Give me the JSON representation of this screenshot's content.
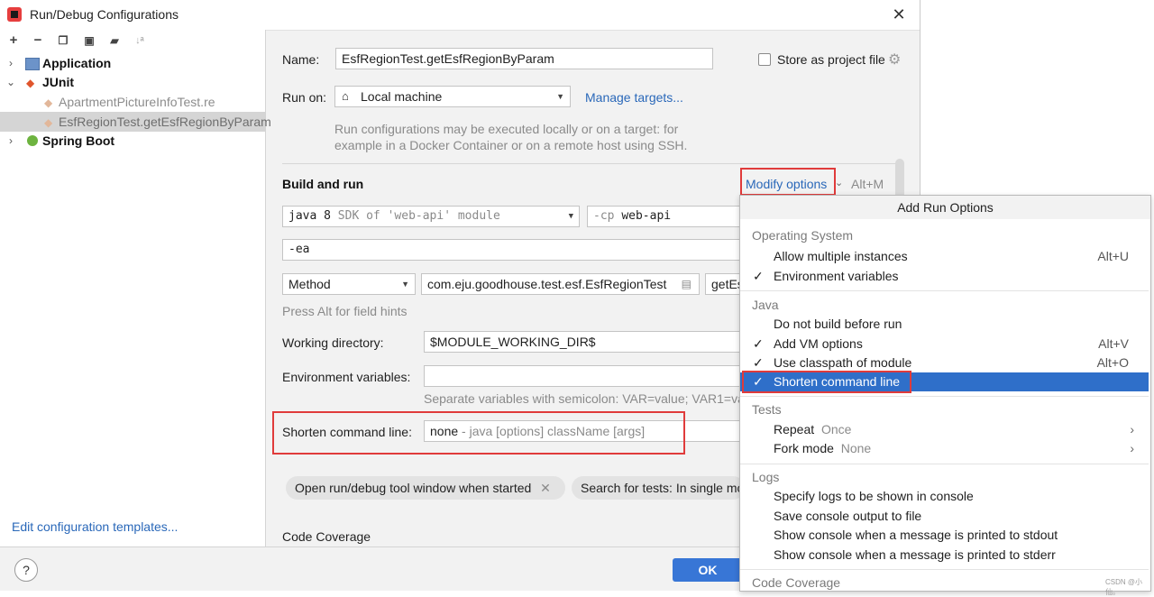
{
  "window": {
    "title": "Run/Debug Configurations"
  },
  "tree": {
    "application": "Application",
    "junit": "JUnit",
    "junit_children": [
      "ApartmentPictureInfoTest.re",
      "EsfRegionTest.getEsfRegionByParam"
    ],
    "spring_boot": "Spring Boot",
    "edit_templates": "Edit configuration templates..."
  },
  "form": {
    "name_label": "Name:",
    "name_value": "EsfRegionTest.getEsfRegionByParam",
    "store_label": "Store as project file",
    "run_on_label": "Run on:",
    "run_on_value": "Local machine",
    "manage_targets": "Manage targets...",
    "run_on_hint_1": "Run configurations may be executed locally or on a target: for",
    "run_on_hint_2": "example in a Docker Container or on a remote host using SSH.",
    "build_run": "Build and run",
    "modify_options": "Modify options",
    "modify_shortcut": "Alt+M",
    "jdk_main": "java 8",
    "jdk_hint": "SDK of 'web-api' module",
    "cp_prefix": "-cp",
    "cp_value": "web-api",
    "vm_options": "-ea",
    "test_kind": "Method",
    "class_value": "com.eju.goodhouse.test.esf.EsfRegionTest",
    "method_value": "getEs",
    "field_hint": "Press Alt for field hints",
    "workdir_label": "Working directory:",
    "workdir_value": "$MODULE_WORKING_DIR$",
    "env_label": "Environment variables:",
    "env_value": "",
    "env_hint": "Separate variables with semicolon: VAR=value; VAR1=va",
    "shorten_label": "Shorten command line:",
    "shorten_value": "none",
    "shorten_hint": "- java [options] className [args]",
    "chip_open_tool": "Open run/debug tool window when started",
    "chip_search": "Search for tests: In single mo",
    "code_coverage": "Code Coverage"
  },
  "buttons": {
    "ok": "OK",
    "help": "?"
  },
  "popup": {
    "title": "Add Run Options",
    "groups": [
      {
        "name": "Operating System",
        "items": [
          {
            "label": "Allow multiple instances",
            "shortcut": "Alt+U",
            "checked": false
          },
          {
            "label": "Environment variables",
            "shortcut": "",
            "checked": true
          }
        ]
      },
      {
        "name": "Java",
        "items": [
          {
            "label": "Do not build before run",
            "shortcut": "",
            "checked": false
          },
          {
            "label": "Add VM options",
            "shortcut": "Alt+V",
            "checked": true
          },
          {
            "label": "Use classpath of module",
            "shortcut": "Alt+O",
            "checked": true
          },
          {
            "label": "Shorten command line",
            "shortcut": "",
            "checked": true
          }
        ]
      },
      {
        "name": "Tests",
        "items": [
          {
            "label": "Repeat",
            "sub": "Once"
          },
          {
            "label": "Fork mode",
            "sub": "None"
          }
        ]
      },
      {
        "name": "Logs",
        "items": [
          {
            "label": "Specify logs to be shown in console"
          },
          {
            "label": "Save console output to file"
          },
          {
            "label": "Show console when a message is printed to stdout"
          },
          {
            "label": "Show console when a message is printed to stderr"
          }
        ]
      },
      {
        "name": "Code Coverage",
        "items": []
      }
    ]
  },
  "checkmark": "✓",
  "watermark": "CSDN @小仙。",
  "colors": {
    "selection": "#2f6fc9",
    "link": "#2a68b9",
    "highlight_box": "#e03b3b",
    "ok_button": "#3876d6"
  }
}
